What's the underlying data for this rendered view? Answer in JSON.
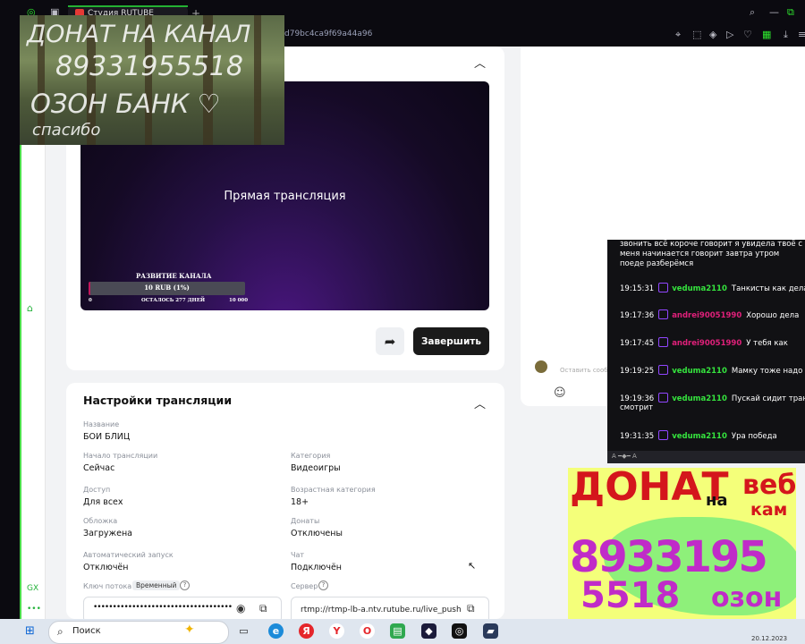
{
  "browser": {
    "tab_title": "Студия RUTUBE",
    "url": "d79bc4ca9f69a44a96",
    "tab_add": "+"
  },
  "player": {
    "video_title": "Прямая трансляция",
    "goal_title": "РАЗВИТИЕ КАНАЛА",
    "goal_amount": "10 RUB (1%)",
    "goal_progress_percent": 1,
    "goal_min": "0",
    "goal_remaining": "ОСТАЛОСЬ 277 ДНЕЙ",
    "goal_max": "10 000",
    "end_button": "Завершить"
  },
  "settings": {
    "title": "Настройки трансляции",
    "name_label": "Название",
    "name_value": "БОИ БЛИЦ",
    "start_label": "Начало трансляции",
    "start_value": "Сейчас",
    "category_label": "Категория",
    "category_value": "Видеоигры",
    "access_label": "Доступ",
    "access_value": "Для всех",
    "age_label": "Возрастная категория",
    "age_value": "18+",
    "cover_label": "Обложка",
    "cover_value": "Загружена",
    "donations_label": "Донаты",
    "donations_value": "Отключены",
    "autostart_label": "Автоматический запуск",
    "autostart_value": "Отключён",
    "chat_label": "Чат",
    "chat_value": "Подключён",
    "key_label": "Ключ потока",
    "key_badge": "Временный",
    "key_value": "••••••••••••••••••••••••••••••••••••••••",
    "server_label": "Сервер",
    "server_value": "rtmp://rtmp-lb-a.ntv.rutube.ru/live_push"
  },
  "chat_overlay": {
    "top_text": "звонить всё короче говорит я увидела твоё с меня начинается говорит завтра утром поеде разберёмся",
    "messages": [
      {
        "time": "19:15:31",
        "user": "veduma2110",
        "user_color": "#35e43e",
        "text": "Танкисты как дела"
      },
      {
        "time": "19:17:36",
        "user": "andrei90051990",
        "user_color": "#e0207a",
        "text": "Хорошо дела"
      },
      {
        "time": "19:17:45",
        "user": "andrei90051990",
        "user_color": "#e0207a",
        "text": "У тебя как"
      },
      {
        "time": "19:19:25",
        "user": "veduma2110",
        "user_color": "#35e43e",
        "text": "Мамку тоже надо к"
      },
      {
        "time": "19:19:36",
        "user": "veduma2110",
        "user_color": "#35e43e",
        "text": "Пускай сидит тран",
        "text2": "смотрит"
      },
      {
        "time": "19:31:35",
        "user": "veduma2110",
        "user_color": "#35e43e",
        "text": "Ура победа"
      }
    ],
    "bottom_label": "A ━◆━ A"
  },
  "comment": {
    "placeholder": "Оставить сооб"
  },
  "overlay_top": {
    "line1": "ДОНАТ НА КАНАЛ",
    "line2": "89331955518",
    "line3": "ОЗОН БАНК ♡",
    "line4": "спасибо"
  },
  "overlay_bottom": {
    "line1": "ДОНАТ",
    "line2": "на",
    "line3": "веб-",
    "line4": "кам",
    "line5": "8933195",
    "line6": "5518",
    "line7": "озон"
  },
  "taskbar": {
    "search_label": "Поиск",
    "date": "20.12.2023"
  },
  "sidebar": {
    "gx_label": "GX",
    "more_label": "•••"
  }
}
